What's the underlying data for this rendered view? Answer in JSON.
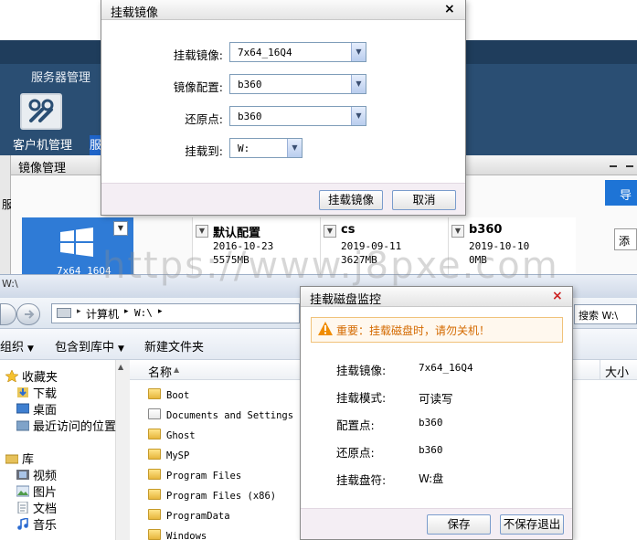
{
  "app": {
    "nav_server": "服务器管理",
    "nav_client_tile": "客户机管理",
    "nav_next_tab_fragment": "服",
    "section_title": "镜像管理",
    "left_strip_text": "服",
    "export_button": "导入",
    "add_button": "添加",
    "cards": [
      {
        "name": "",
        "date": "",
        "size": "",
        "label": "7x64_16Q4"
      },
      {
        "name": "默认配置",
        "date": "2016-10-23",
        "size": "5575MB"
      },
      {
        "name": "cs",
        "date": "2019-09-11",
        "size": "3627MB"
      },
      {
        "name": "b360",
        "date": "2019-10-10",
        "size": "0MB"
      }
    ]
  },
  "mount_dialog": {
    "title": "挂载镜像",
    "close": "×",
    "fields": [
      {
        "label": "挂载镜像:",
        "value": "7x64_16Q4"
      },
      {
        "label": "镜像配置:",
        "value": "b360"
      },
      {
        "label": "还原点:",
        "value": "b360"
      },
      {
        "label": "挂载到:",
        "value": "W:"
      }
    ],
    "ok_button": "挂载镜像",
    "cancel_button": "取消"
  },
  "explorer": {
    "title": "W:\\",
    "address": {
      "computer": "计算机",
      "drive": "W:\\"
    },
    "search_placeholder": "搜索 W:\\",
    "toolbar": {
      "organize": "组织",
      "include": "包含到库中",
      "new_folder": "新建文件夹"
    },
    "nav": {
      "favorites": "收藏夹",
      "downloads": "下载",
      "desktop": "桌面",
      "recent": "最近访问的位置",
      "libraries": "库",
      "videos": "视频",
      "pictures": "图片",
      "documents": "文档",
      "music": "音乐"
    },
    "columns": {
      "name": "名称",
      "size": "大小"
    },
    "files": [
      "Boot",
      "Documents and Settings",
      "Ghost",
      "MySP",
      "Program Files",
      "Program Files (x86)",
      "ProgramData",
      "Windows"
    ]
  },
  "monitor_dialog": {
    "title": "挂载磁盘监控",
    "close": "×",
    "warning": "重要：挂载磁盘时，请勿关机！",
    "rows": [
      {
        "label": "挂载镜像:",
        "value": "7x64_16Q4"
      },
      {
        "label": "挂载模式:",
        "value": "可读写"
      },
      {
        "label": "配置点:",
        "value": "b360"
      },
      {
        "label": "还原点:",
        "value": "b360"
      },
      {
        "label": "挂载盘符:",
        "value": "W:盘"
      }
    ],
    "save_button": "保存",
    "nosave_button": "不保存退出"
  },
  "watermark": "https://www.j8pxe.com"
}
